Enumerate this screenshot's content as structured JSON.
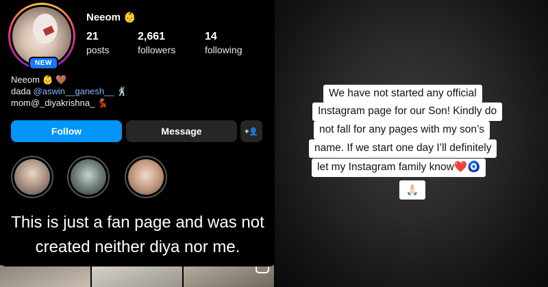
{
  "profile": {
    "username": "Neeom 👶",
    "badge": "NEW",
    "stats": [
      {
        "value": "21",
        "label": "posts"
      },
      {
        "value": "2,661",
        "label": "followers"
      },
      {
        "value": "14",
        "label": "following"
      }
    ],
    "bio": {
      "line1": "Neeom 👶 🤎",
      "line2_prefix": "dada ",
      "line2_mention": "@aswin__ganesh__",
      "line2_suffix": " 🕺",
      "line3": "mom@_diyakrishna_ 💃"
    },
    "buttons": {
      "follow": "Follow",
      "message": "Message",
      "add_user": "+👤"
    }
  },
  "caption": {
    "line1": "This is just a fan page and was not",
    "line2": "created neither diya nor me."
  },
  "story_note": {
    "lines": [
      "We have not started any official",
      "Instagram page for our Son! Kindly do",
      "not fall for any pages with my son’s",
      "name. If we start one day I’ll definitely",
      "let my Instagram family know❤️🧿"
    ],
    "emoji_line": "🙏🏻"
  }
}
